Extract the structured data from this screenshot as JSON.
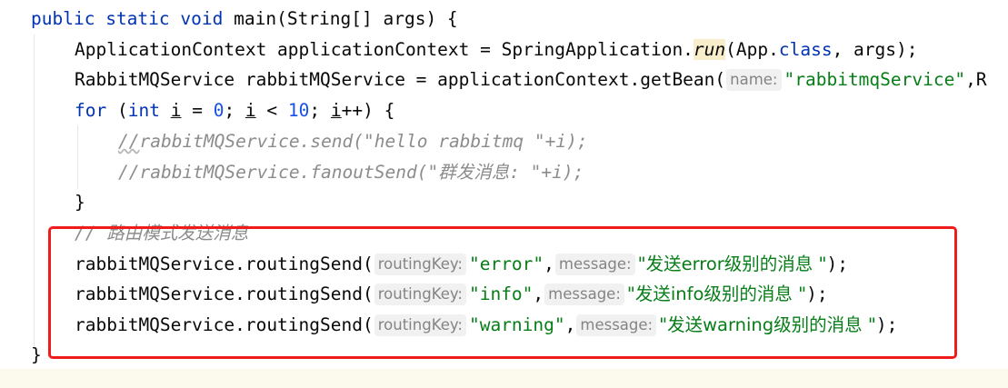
{
  "code": {
    "line1": {
      "public": "public",
      "static": "static",
      "void": "void",
      "name": "main",
      "sig": "(String[] args) {"
    },
    "line2": {
      "pre": "ApplicationContext applicationContext = SpringApplication.",
      "call": "run",
      "mid": "(App.",
      "kw_class": "class",
      "post": ", args);"
    },
    "line3": {
      "pre": "RabbitMQService rabbitMQService = applicationContext.getBean(",
      "hint": "name:",
      "str": "\"rabbitmqService\"",
      "post": ",R"
    },
    "line4": {
      "for": "for",
      "p1": " (",
      "int": "int",
      "sp": " ",
      "i1": "i",
      "eq": " = ",
      "zero": "0",
      "semi1": "; ",
      "i2": "i",
      "lt": " < ",
      "ten": "10",
      "semi2": "; ",
      "i3": "i",
      "inc": "++) {"
    },
    "line5": {
      "slashes": "//",
      "text": "rabbitMQService.send(\"hello rabbitmq \"+i);"
    },
    "line6": {
      "text": "//rabbitMQService.fanoutSend(\"群发消息: \"+i);"
    },
    "line7": {
      "text": "}"
    },
    "line8": {
      "text": "// 路由模式发送消息"
    },
    "line9": {
      "pre": "rabbitMQService.routingSend(",
      "hint1": "routingKey:",
      "key": "\"error\"",
      "comma": ",",
      "hint2": "message:",
      "msg": "\"发送error级别的消息 \"",
      "post": ");"
    },
    "line10": {
      "pre": "rabbitMQService.routingSend(",
      "hint1": "routingKey:",
      "key": "\"info\"",
      "comma": ",",
      "hint2": "message:",
      "msg": "\"发送info级别的消息 \"",
      "post": ");"
    },
    "line11": {
      "pre": "rabbitMQService.routingSend(",
      "hint1": "routingKey:",
      "key": "\"warning\"",
      "comma": ",",
      "hint2": "message:",
      "msg": "\"发送warning级别的消息 \"",
      "post": ");"
    },
    "line12": {
      "text": "}"
    }
  },
  "colors": {
    "keyword": "#0033b3",
    "string": "#067d17",
    "number": "#1750eb",
    "comment": "#8c8c8c",
    "highlight_box": "#f01c1c"
  }
}
